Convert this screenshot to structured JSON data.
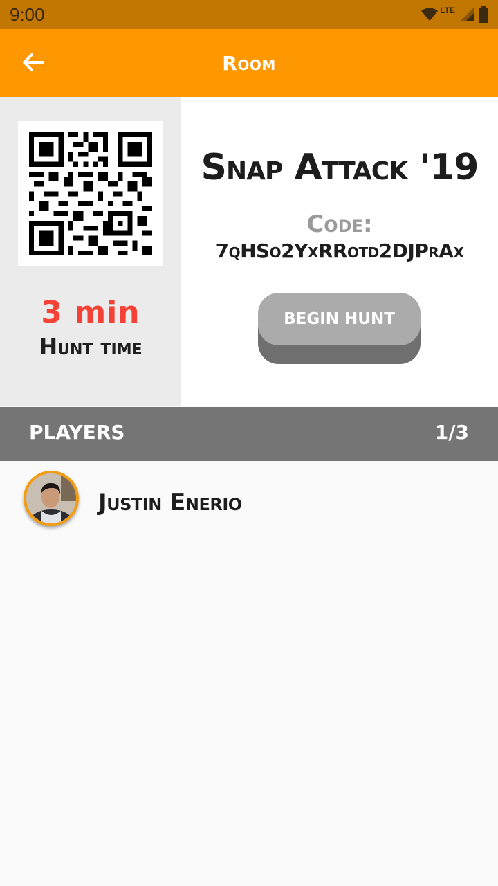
{
  "status_bar": {
    "time": "9:00",
    "network_label": "LTE",
    "icons": [
      "wifi-icon",
      "signal-icon",
      "battery-icon"
    ]
  },
  "app_bar": {
    "title": "Room",
    "back_icon": "arrow-back-icon",
    "color": "#ff9800"
  },
  "room": {
    "name": "Snap Attack '19",
    "code_label": "Code:",
    "code": "7qHSo2YxRRotd2DJPrAx",
    "hunt_time_value": "3 min",
    "hunt_time_label": "Hunt time",
    "begin_button_label": "BEGIN HUNT",
    "qr_icon": "qr-code-icon"
  },
  "players": {
    "title": "PLAYERS",
    "count": "1/3",
    "list": [
      {
        "name": "Justin Enerio",
        "avatar_icon": "avatar-photo"
      }
    ]
  },
  "colors": {
    "accent": "#ff9800",
    "status_bar": "#c17700",
    "hunt_time": "#f44336",
    "players_header": "#757575"
  }
}
